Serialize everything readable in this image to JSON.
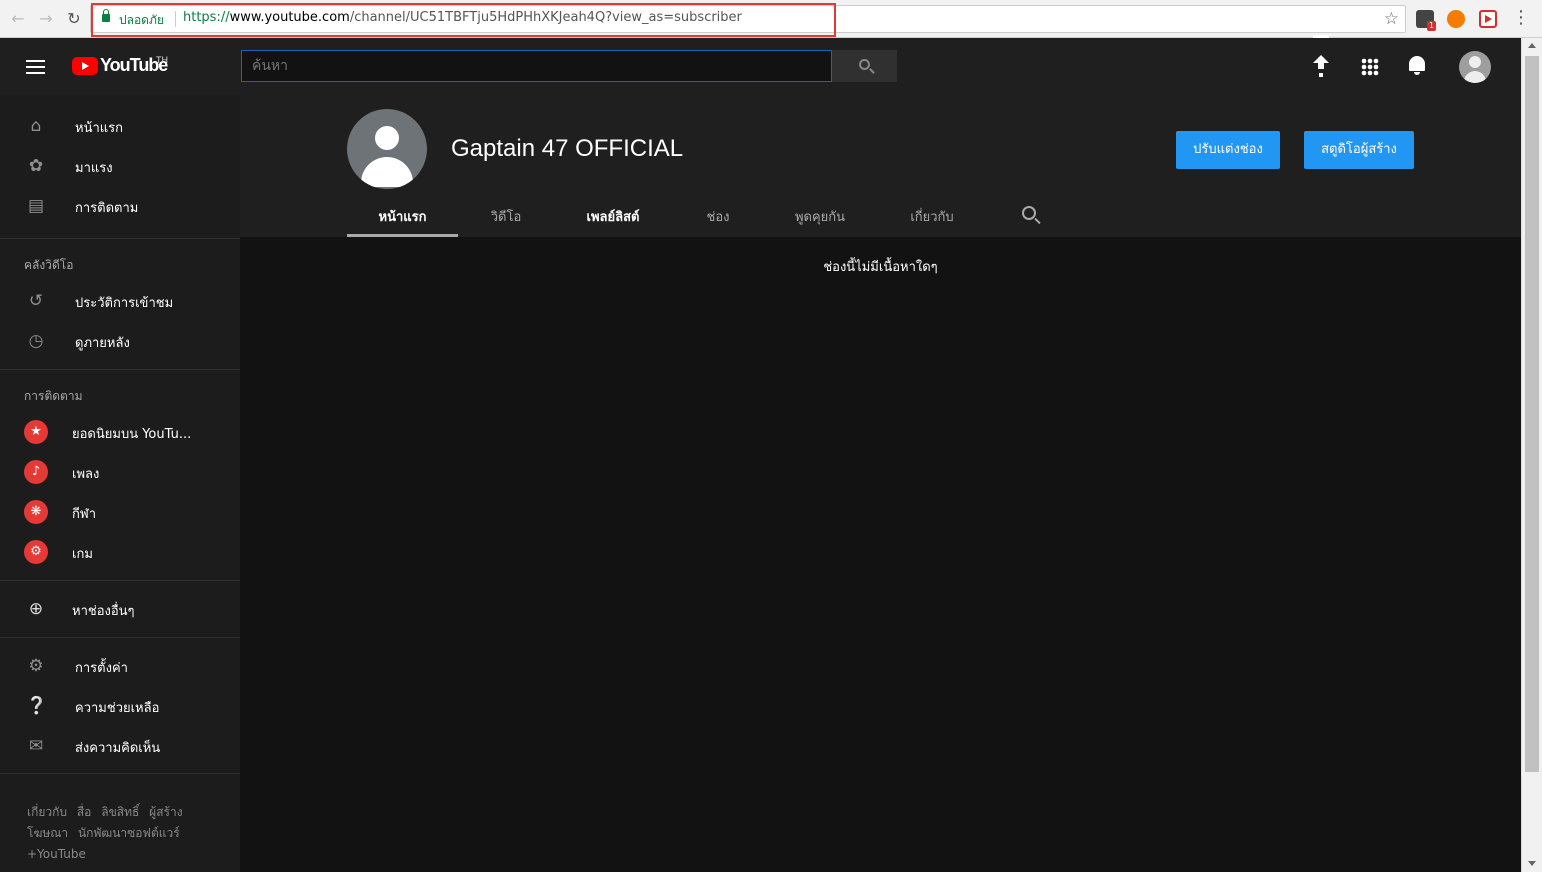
{
  "browser": {
    "secure_label": "ปลอดภัย",
    "url_scheme": "https://",
    "url_host": "www.youtube.com",
    "url_path": "/channel/UC51TBFTju5HdPHhXKJeah4Q?view_as=subscriber",
    "ext_badge": "1"
  },
  "masthead": {
    "wordmark": "YouTube",
    "region": "TH",
    "search_placeholder": "ค้นหา"
  },
  "sidebar": {
    "main_items": [
      {
        "label": "หน้าแรก",
        "icon": "home-icon"
      },
      {
        "label": "มาแรง",
        "icon": "trending-icon"
      },
      {
        "label": "การติดตาม",
        "icon": "subscriptions-icon"
      }
    ],
    "library_heading": "คลังวิดีโอ",
    "library_items": [
      {
        "label": "ประวัติการเข้าชม",
        "icon": "history-icon"
      },
      {
        "label": "ดูภายหลัง",
        "icon": "watch-later-icon"
      }
    ],
    "subs_heading": "การติดตาม",
    "subs_items": [
      {
        "label": "ยอดนิยมบน YouTu...",
        "icon": "star-icon"
      },
      {
        "label": "เพลง",
        "icon": "music-note-icon"
      },
      {
        "label": "กีฬา",
        "icon": "basketball-icon"
      },
      {
        "label": "เกม",
        "icon": "gamepad-icon"
      }
    ],
    "browse_channels": "หาช่องอื่นๆ",
    "settings_items": [
      {
        "label": "การตั้งค่า",
        "icon": "gear-icon"
      },
      {
        "label": "ความช่วยเหลือ",
        "icon": "help-icon"
      },
      {
        "label": "ส่งความคิดเห็น",
        "icon": "feedback-icon"
      }
    ],
    "footer": {
      "line1": [
        "เกี่ยวกับ",
        "สื่อ",
        "ลิขสิทธิ์",
        "ผู้สร้าง"
      ],
      "line2": [
        "โฆษณา",
        "นักพัฒนาซอฟต์แวร์"
      ],
      "line3": [
        "+YouTube"
      ]
    }
  },
  "channel": {
    "name": "Gaptain 47 OFFICIAL",
    "customize_button": "ปรับแต่งช่อง",
    "studio_button": "สตูดิโอผู้สร้าง",
    "tabs": [
      "หน้าแรก",
      "วิดีโอ",
      "เพลย์ลิสต์",
      "ช่อง",
      "พูดคุยกัน",
      "เกี่ยวกับ"
    ],
    "empty_message": "ช่องนี้ไม่มีเนื้อหาใดๆ"
  },
  "colors": {
    "accent_blue": "#2196f3",
    "brand_red": "#ff0000",
    "background": "#121212"
  }
}
